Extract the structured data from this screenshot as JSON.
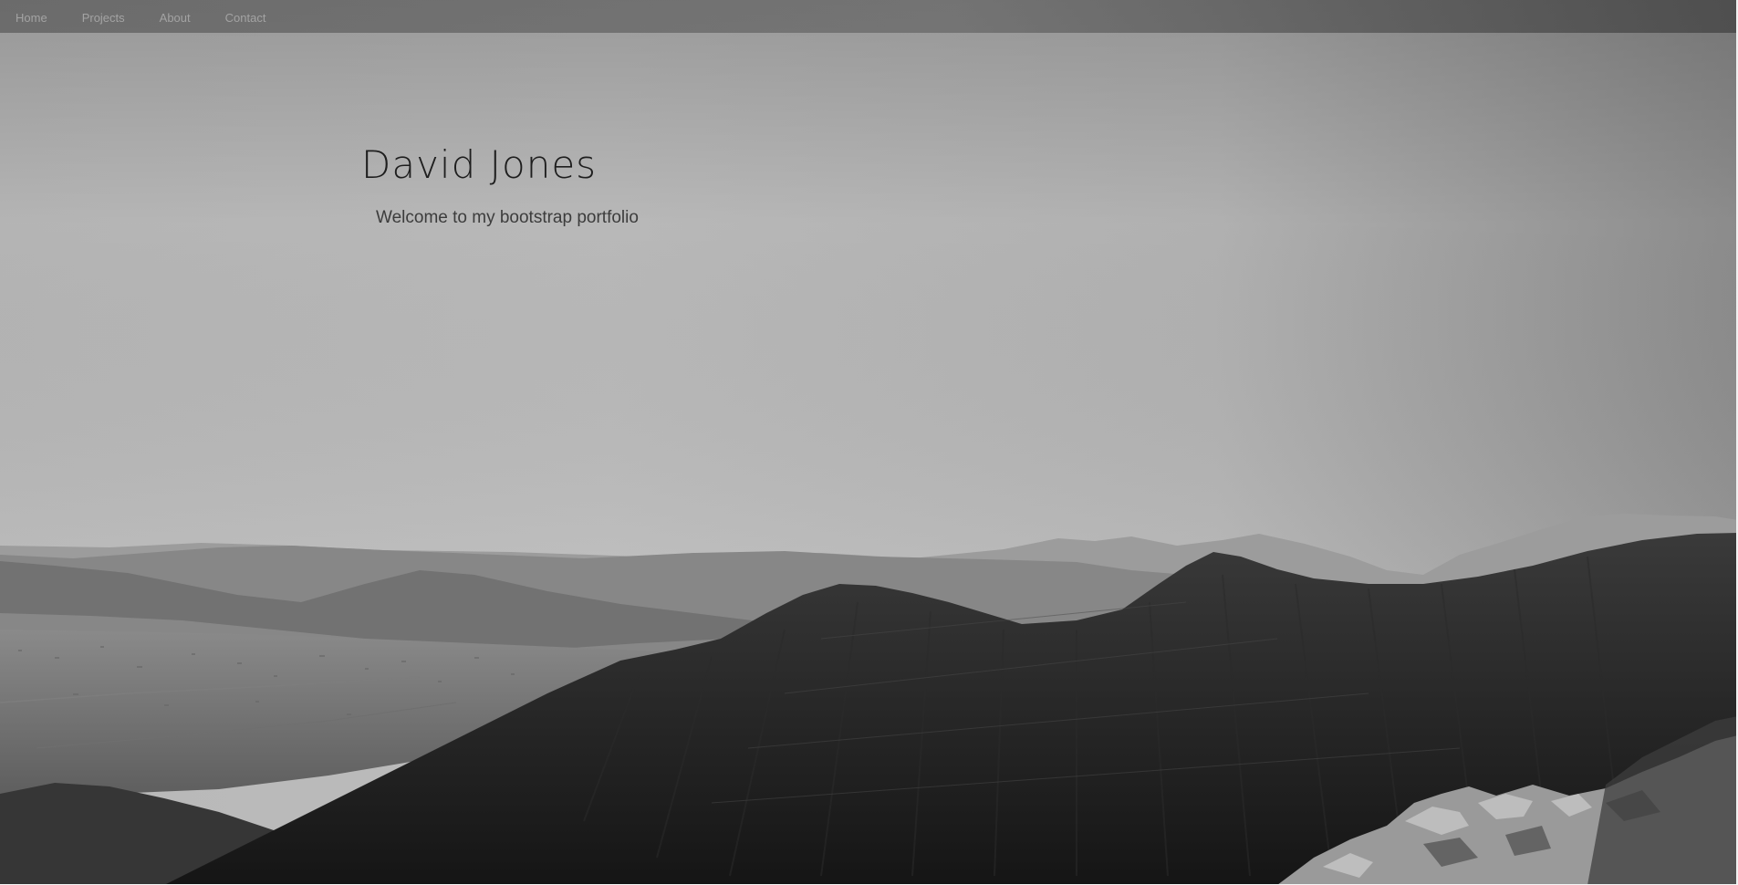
{
  "nav": {
    "items": [
      {
        "label": "Home"
      },
      {
        "label": "Projects"
      },
      {
        "label": "About"
      },
      {
        "label": "Contact"
      }
    ]
  },
  "hero": {
    "title": "David Jones",
    "subtitle": "Welcome to my bootstrap portfolio",
    "background_image": "black-and-white mountain landscape photo",
    "colors": {
      "sky": "#bdbdbd",
      "mountains_far": "#8a8a8a",
      "mountains_mid": "#5c5c5c",
      "forest": "#262626"
    }
  }
}
